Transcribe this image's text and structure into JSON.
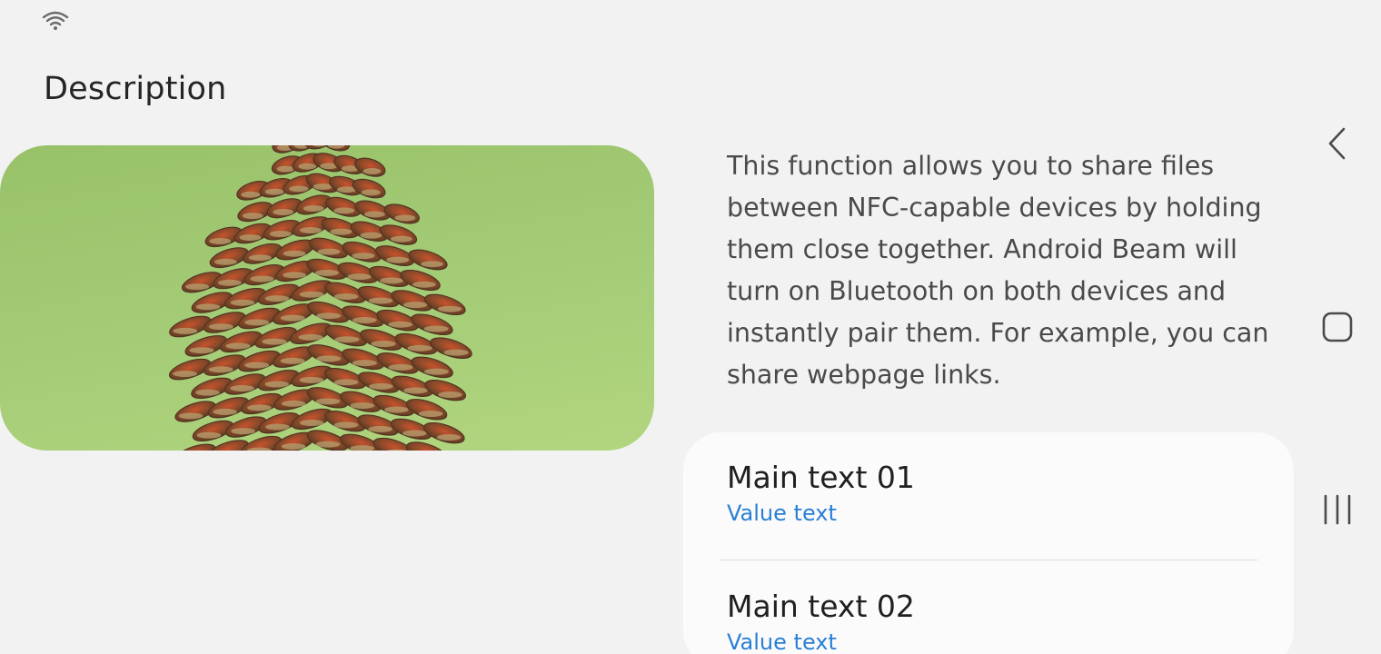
{
  "status_bar": {
    "wifi_icon": "wifi-icon"
  },
  "header": {
    "title": "Description"
  },
  "image": {
    "subject": "pinecone",
    "background_color": "#a5cc77"
  },
  "description": {
    "text": "This function allows you to share files between NFC-capable devices by holding them close together. Android Beam will turn on Bluetooth on both devices and instantly pair them. For example, you can share webpage links."
  },
  "list": {
    "items": [
      {
        "main": "Main text 01",
        "value": "Value text"
      },
      {
        "main": "Main text 02",
        "value": "Value text"
      }
    ]
  },
  "nav_bar": {
    "back_icon": "back-icon",
    "home_icon": "home-icon",
    "recents_icon": "recents-icon"
  },
  "colors": {
    "background": "#f2f2f2",
    "accent": "#2a7fd4",
    "card": "#fbfbfb"
  }
}
